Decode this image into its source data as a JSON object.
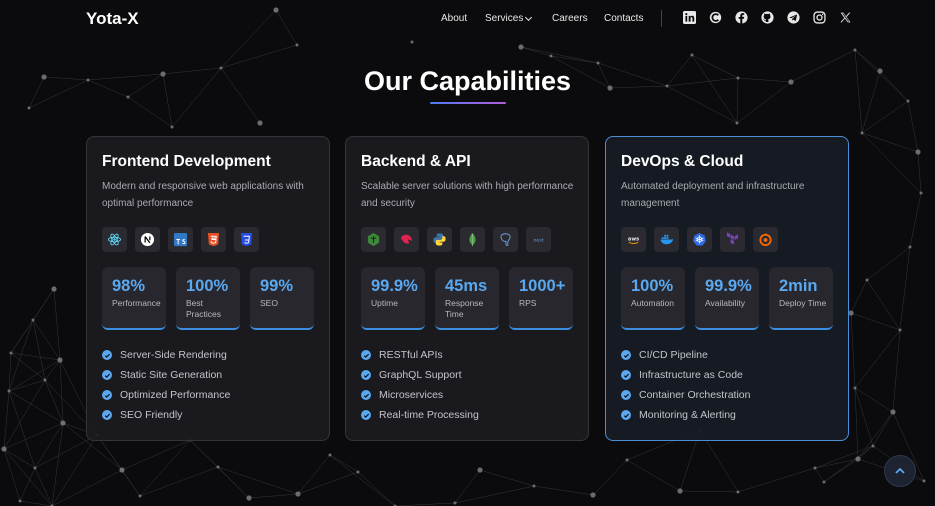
{
  "nav": {
    "brand": "Yota-X",
    "links": [
      "About",
      "Services",
      "Careers",
      "Contacts"
    ],
    "socials": [
      "linkedin-icon",
      "codechef-icon",
      "facebook-icon",
      "github-icon",
      "telegram-icon",
      "instagram-icon",
      "x-icon"
    ]
  },
  "section": {
    "title": "Our Capabilities",
    "accent": "#3b8de0"
  },
  "cards": [
    {
      "title": "Frontend Development",
      "description": "Modern and responsive web applications with optimal performance",
      "tech": [
        "react-icon",
        "nextjs-icon",
        "typescript-icon",
        "html5-icon",
        "css3-icon"
      ],
      "metrics": [
        {
          "value": "98%",
          "label": "Performance"
        },
        {
          "value": "100%",
          "label": "Best Practices"
        },
        {
          "value": "99%",
          "label": "SEO"
        }
      ],
      "features": [
        "Server-Side Rendering",
        "Static Site Generation",
        "Optimized Performance",
        "SEO Friendly"
      ]
    },
    {
      "title": "Backend & API",
      "description": "Scalable server solutions with high performance and security",
      "tech": [
        "nodejs-icon",
        "nestjs-icon",
        "python-icon",
        "mongodb-icon",
        "postgresql-icon",
        "nestjs-text-icon"
      ],
      "metrics": [
        {
          "value": "99.9%",
          "label": "Uptime"
        },
        {
          "value": "45ms",
          "label": "Response Time"
        },
        {
          "value": "1000+",
          "label": "RPS"
        }
      ],
      "features": [
        "RESTful APIs",
        "GraphQL Support",
        "Microservices",
        "Real-time Processing"
      ]
    },
    {
      "title": "DevOps & Cloud",
      "description": "Automated deployment and infrastructure management",
      "tech": [
        "aws-icon",
        "docker-icon",
        "kubernetes-icon",
        "terraform-icon",
        "grafana-icon"
      ],
      "metrics": [
        {
          "value": "100%",
          "label": "Automation"
        },
        {
          "value": "99.9%",
          "label": "Availability"
        },
        {
          "value": "2min",
          "label": "Deploy Time"
        }
      ],
      "features": [
        "CI/CD Pipeline",
        "Infrastructure as Code",
        "Container Orchestration",
        "Monitoring & Alerting"
      ]
    }
  ]
}
